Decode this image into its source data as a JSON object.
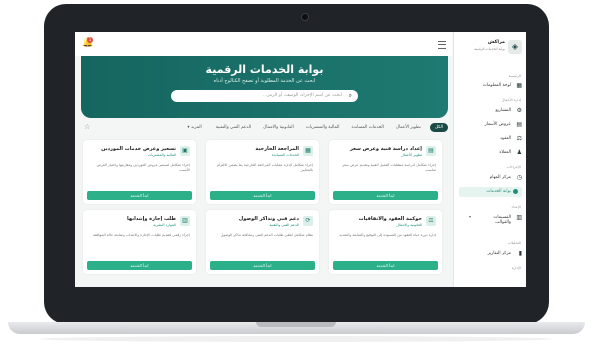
{
  "header": {
    "notification_count": "1"
  },
  "hero": {
    "title": "بوابة الخدمات الرقمية",
    "subtitle": "ابحث عن الخدمة المطلوبة أو تصفح الكتالوج أدناه",
    "search_placeholder": "ابحث عن اسم الإجراء، الوصف، أو الرمز..."
  },
  "tabs": [
    "الكل",
    "تطوير الأعمال",
    "الخدمات المساندة",
    "المالية والمشتريات",
    "القانونية والامتثال",
    "الدعم الفني والتقنية"
  ],
  "tabs_more": "المزيد",
  "cards": [
    {
      "title": "إعداد دراسة فنية وعرض سعر",
      "category": "تطوير الأعمال",
      "desc": "إجراء متكامل لدراسة متطلبات العميل الفنية وتقديم عرض سعر مناسب",
      "button": "ابدأ الخدمة"
    },
    {
      "title": "المراجعة الخارجية",
      "category": "الخدمات المساندة",
      "desc": "إجراء متكامل لإدارة عمليات المراجعة الخارجية بما يضمن الالتزام بالمعايير",
      "button": "ابدأ الخدمة"
    },
    {
      "title": "تسعير وعرض خدمات الموردين",
      "category": "المالية والمشتريات",
      "desc": "إجراء متكامل لتسعير عروض الموردين ومقارنتها واختيار العرض الأنسب",
      "button": "ابدأ الخدمة"
    },
    {
      "title": "حوكمة العقود والاتفاقيات",
      "category": "القانونية والامتثال",
      "desc": "إدارة دورة حياة العقود من المسودة إلى التوقيع والمتابعة والتجديد",
      "button": "ابدأ الخدمة"
    },
    {
      "title": "دعم فني وتذاكر الوصول",
      "category": "الدعم الفني والتقنية",
      "desc": "نظام متكامل لتلقي طلبات الدعم الفني ومعالجة تذاكر الوصول",
      "button": "ابدأ الخدمة"
    },
    {
      "title": "طلب إجازة وإنتدابها",
      "category": "الموارد البشرية",
      "desc": "إجراء رقمي لتقديم طلبات الإجازة والانتداب ومتابعة حالة الموافقة",
      "button": "ابدأ الخدمة"
    }
  ],
  "sidebar": {
    "logo_title": "مراكش",
    "logo_sub": "بوابة الخدمات الرقمية",
    "sections": [
      {
        "label": "الرئيسية",
        "items": [
          {
            "label": "لوحة المعلومات",
            "icon": "dashboard-icon"
          }
        ]
      },
      {
        "label": "إدارة الأعمال",
        "items": [
          {
            "label": "المشاريع",
            "icon": "projects-icon"
          },
          {
            "label": "عروض الأسعار",
            "icon": "quotes-icon"
          },
          {
            "label": "العقود",
            "icon": "contracts-icon"
          },
          {
            "label": "العملاء",
            "icon": "clients-icon"
          }
        ]
      },
      {
        "label": "الإجراءات",
        "items": [
          {
            "label": "مركز المهام",
            "icon": "tasks-icon"
          },
          {
            "label": "بوابة الخدمات",
            "icon": "services-icon",
            "active": true
          }
        ]
      },
      {
        "label": "الإعداد",
        "items": [
          {
            "label": "القسيمات والقوالب",
            "icon": "templates-icon"
          }
        ]
      },
      {
        "label": "التحليلات",
        "items": [
          {
            "label": "مركز التقارير",
            "icon": "reports-icon"
          }
        ]
      },
      {
        "label": "الإدارة",
        "items": []
      }
    ]
  },
  "colors": {
    "primary": "#1e7a72",
    "accent": "#2bb089",
    "active_tab": "#1a4a45"
  }
}
